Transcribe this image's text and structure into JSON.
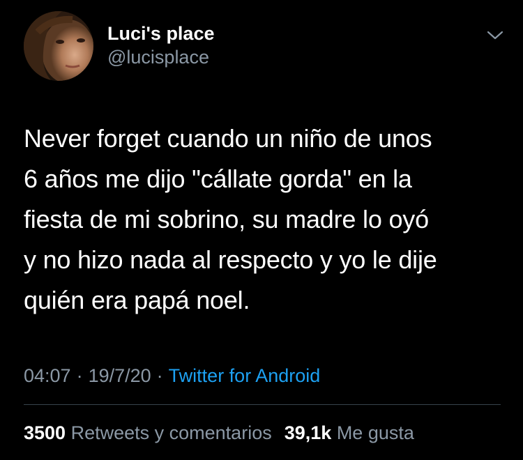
{
  "user": {
    "display_name": "Luci's place",
    "username": "@lucisplace",
    "avatar_icon": "profile-photo"
  },
  "tweet": {
    "text": "Never forget cuando un niño de unos\n6 años me dijo \"cállate gorda\" en la\nfiesta de mi sobrino, su madre lo oyó\ny no hizo nada al respecto y yo le dije\nquién era papá noel.",
    "time": "04:07",
    "separator": "·",
    "date": "19/7/20",
    "source": "Twitter for Android"
  },
  "stats": {
    "retweets_count": "3500",
    "retweets_label": "Retweets y comentarios",
    "likes_count": "39,1k",
    "likes_label": "Me gusta"
  },
  "colors": {
    "background": "#000000",
    "text": "#ffffff",
    "secondary": "#8b98a5",
    "link": "#1da1f2",
    "divider": "#38444d"
  }
}
